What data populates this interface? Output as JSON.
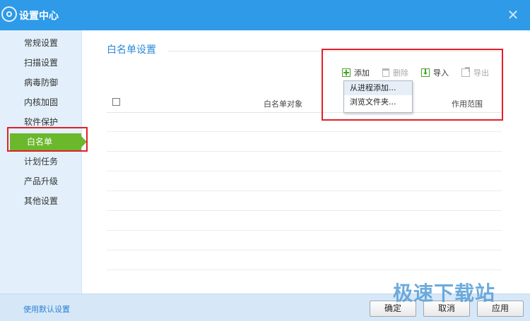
{
  "window": {
    "title": "设置中心",
    "close_glyph": "✕"
  },
  "sidebar": {
    "items": [
      {
        "label": "常规设置"
      },
      {
        "label": "扫描设置"
      },
      {
        "label": "病毒防御"
      },
      {
        "label": "内核加固"
      },
      {
        "label": "软件保护"
      },
      {
        "label": "白名单",
        "active": true
      },
      {
        "label": "计划任务"
      },
      {
        "label": "产品升级"
      },
      {
        "label": "其他设置"
      }
    ]
  },
  "main": {
    "section_title": "白名单设置",
    "toolbar": {
      "add": "添加",
      "delete": "删除",
      "import": "导入",
      "export": "导出"
    },
    "add_menu": [
      "从进程添加...",
      "浏览文件夹..."
    ],
    "table": {
      "col_object": "白名单对象",
      "col_scope": "作用范围",
      "rows": []
    }
  },
  "footer": {
    "default_link": "使用默认设置",
    "ok": "确定",
    "cancel": "取消",
    "apply": "应用"
  },
  "watermark": "极速下载站",
  "colors": {
    "titlebar": "#2e9ae8",
    "sidebar_bg": "#e3f0fb",
    "active_item": "#6bb82d",
    "highlight_frame": "#e21f26",
    "accent_text": "#2d8ad8"
  }
}
